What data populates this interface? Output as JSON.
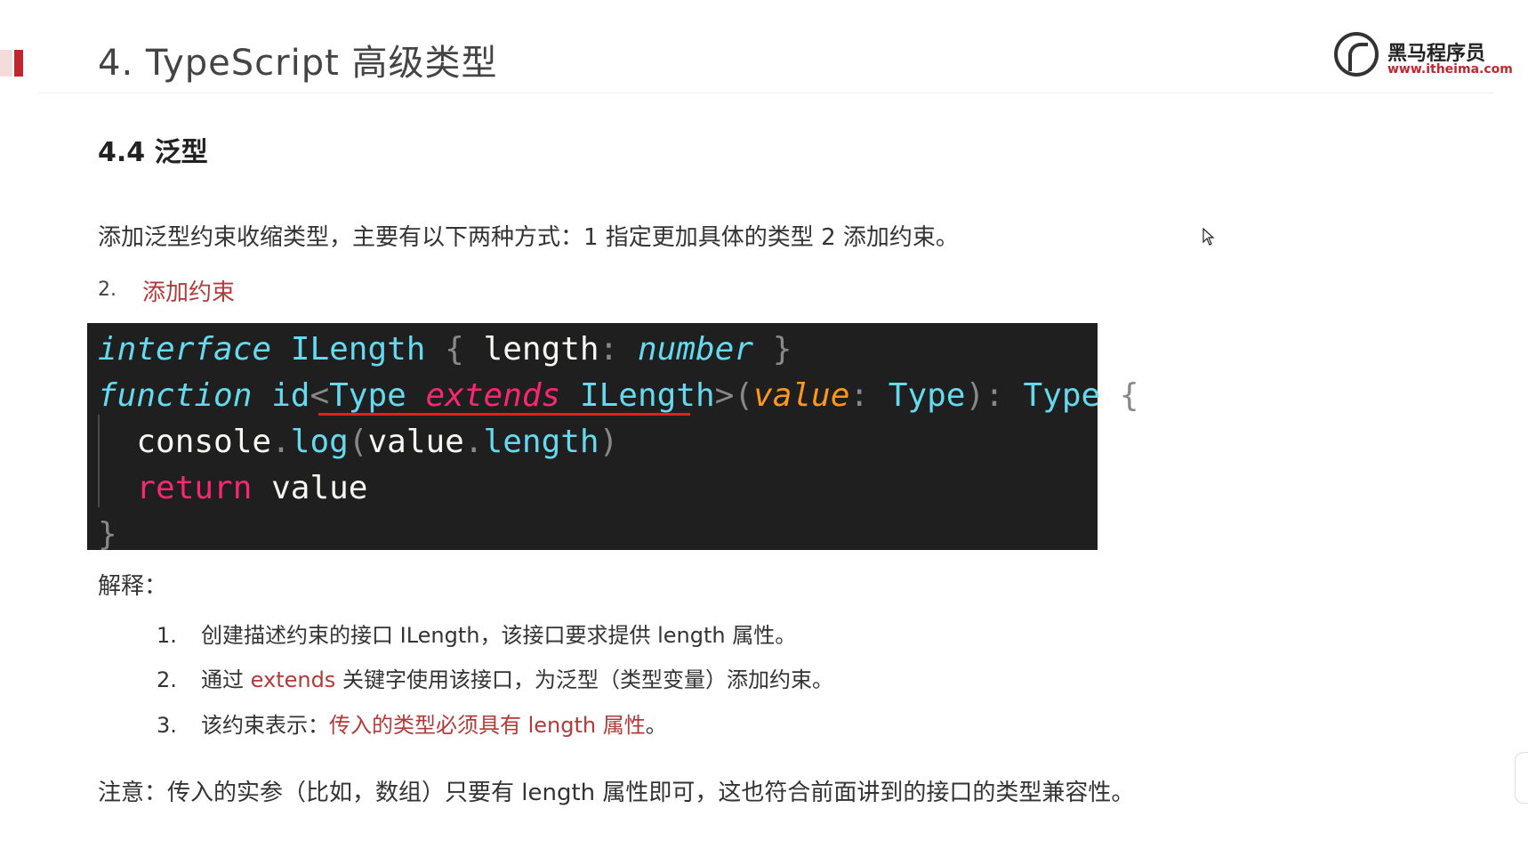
{
  "header": {
    "title": "4. TypeScript 高级类型",
    "logo": {
      "name": "黑马程序员",
      "url": "www.itheima.com"
    }
  },
  "section": {
    "title": "4.4 泛型"
  },
  "intro": "添加泛型约束收缩类型，主要有以下两种方式：1 指定更加具体的类型  2 添加约束。",
  "step": {
    "number": "2.",
    "label": "添加约束"
  },
  "code": {
    "line1": {
      "kw": "interface",
      "name": "ILength",
      "open": "{",
      "prop": "length",
      "colon": ":",
      "ptype": "number",
      "close": "}"
    },
    "line2": {
      "kw": "function",
      "fname": "id",
      "lt": "<",
      "tparam": "Type",
      "ext": "extends",
      "constraint": "ILength",
      "gt": ">",
      "lparen": "(",
      "param": "value",
      "colon": ":",
      "ptype": "Type",
      "rparen": ")",
      "colon2": ":",
      "ret": "Type",
      "open": "{"
    },
    "line3": {
      "obj": "console",
      "dot": ".",
      "method": "log",
      "lparen": "(",
      "arg": "value",
      "dot2": ".",
      "prop": "length",
      "rparen": ")"
    },
    "line4": {
      "kw": "return",
      "val": "value"
    },
    "line5": {
      "close": "}"
    }
  },
  "explain": {
    "title": "解释：",
    "items": [
      {
        "num": "1.",
        "text": "创建描述约束的接口 ILength，该接口要求提供 length 属性。"
      },
      {
        "num": "2.",
        "pre": "通过 ",
        "highlight": "extends",
        "post": " 关键字使用该接口，为泛型（类型变量）添加约束。"
      },
      {
        "num": "3.",
        "pre": "该约束表示：",
        "highlight": "传入的类型必须具有 length 属性",
        "post": "。"
      }
    ]
  },
  "note": "注意：传入的实参（比如，数组）只要有 length 属性即可，这也符合前面讲到的接口的类型兼容性。",
  "colors": {
    "accent": "#c0272d",
    "highlight": "#b23a3a",
    "code_bg": "#1f1f1f"
  }
}
